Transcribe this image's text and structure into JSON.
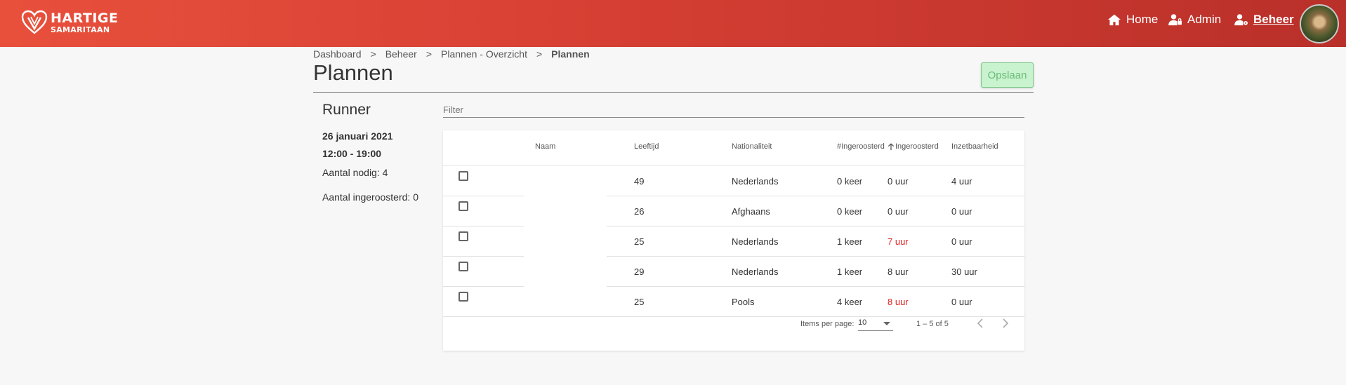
{
  "header": {
    "logo_line1": "HARTIGE",
    "logo_line2": "SAMARITAAN",
    "nav": {
      "home": "Home",
      "admin": "Admin",
      "beheer": "Beheer"
    },
    "icons": [
      "home-icon",
      "admin-icon",
      "user-gear-icon",
      "avatar"
    ],
    "gradient_colors": [
      "#e8503c",
      "#b9302a"
    ]
  },
  "breadcrumb": {
    "items": [
      "Dashboard",
      "Beheer",
      "Plannen - Overzicht"
    ],
    "current": "Plannen",
    "separator": ">"
  },
  "page": {
    "title": "Plannen",
    "save_label": "Opslaan"
  },
  "sidebar": {
    "title": "Runner",
    "date": "26 januari 2021",
    "time": "12:00 - 19:00",
    "needed": "Aantal nodig: 4",
    "scheduled": "Aantal ingeroosterd: 0"
  },
  "filter": {
    "placeholder": "Filter",
    "value": ""
  },
  "table": {
    "headers": {
      "naam": "Naam",
      "leeftijd": "Leeftijd",
      "nationaliteit": "Nationaliteit",
      "count": "#Ingeroosterd",
      "hours": "Ingeroosterd",
      "inzetbaarheid": "Inzetbaarheid"
    },
    "sorted_column": "hours",
    "sort_direction": "ascending",
    "highlight_color": "#e02020",
    "rows": [
      {
        "checked": false,
        "naam": "",
        "leeftijd": "49",
        "nationaliteit": "Nederlands",
        "count": "0 keer",
        "hours": "0 uur",
        "hours_red": false,
        "inzetbaarheid": "4 uur"
      },
      {
        "checked": false,
        "naam": "",
        "leeftijd": "26",
        "nationaliteit": "Afghaans",
        "count": "0 keer",
        "hours": "0 uur",
        "hours_red": false,
        "inzetbaarheid": "0 uur"
      },
      {
        "checked": false,
        "naam": "",
        "leeftijd": "25",
        "nationaliteit": "Nederlands",
        "count": "1 keer",
        "hours": "7 uur",
        "hours_red": true,
        "inzetbaarheid": "0 uur"
      },
      {
        "checked": false,
        "naam": "",
        "leeftijd": "29",
        "nationaliteit": "Nederlands",
        "count": "1 keer",
        "hours": "8 uur",
        "hours_red": false,
        "inzetbaarheid": "30 uur"
      },
      {
        "checked": false,
        "naam": "",
        "leeftijd": "25",
        "nationaliteit": "Pools",
        "count": "4 keer",
        "hours": "8 uur",
        "hours_red": true,
        "inzetbaarheid": "0 uur"
      }
    ]
  },
  "paginator": {
    "items_per_page_label": "Items per page:",
    "page_size": "10",
    "range": "1 – 5 of 5"
  }
}
